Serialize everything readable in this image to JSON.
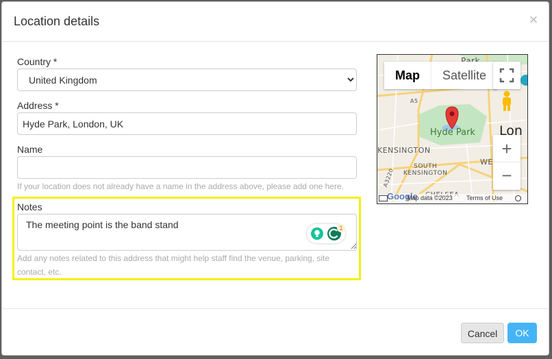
{
  "modal": {
    "title": "Location details",
    "close_symbol": "×"
  },
  "form": {
    "country": {
      "label": "Country *",
      "selected": "United Kingdom"
    },
    "address": {
      "label": "Address *",
      "value": "Hyde Park, London, UK"
    },
    "name": {
      "label": "Name",
      "value": "",
      "help": "If your location does not already have a name in the address above, please add one here."
    },
    "notes": {
      "label": "Notes",
      "value": "The meeting point is the band stand",
      "help": "Add any notes related to this address that might help staff find the venue, parking, site contact, etc.",
      "highlight_color": "#f5f00c"
    },
    "grammar_widget": {
      "badge_count": "1",
      "icon": "grammarly-icon"
    }
  },
  "map": {
    "type_buttons": [
      "Map",
      "Satellite"
    ],
    "place_labels": {
      "park_top": "Park",
      "hyde_park": "Hyde Park",
      "london": "Lon",
      "kensington": "KENSINGTON",
      "south_kensington": "SOUTH\nKENSINGTON",
      "west": "WE",
      "chelsea": "CHELSEA",
      "road_a5": "A5",
      "road_a3220": "A3220"
    },
    "zoom_in": "+",
    "zoom_out": "−",
    "footer": {
      "google": "Google",
      "map_data": "Map data ©2023",
      "terms": "Terms of Use"
    },
    "marker_color": "#e53935",
    "park_color": "#c4e5c1"
  },
  "footer": {
    "cancel_label": "Cancel",
    "ok_label": "OK",
    "ok_color": "#45b4f6"
  }
}
